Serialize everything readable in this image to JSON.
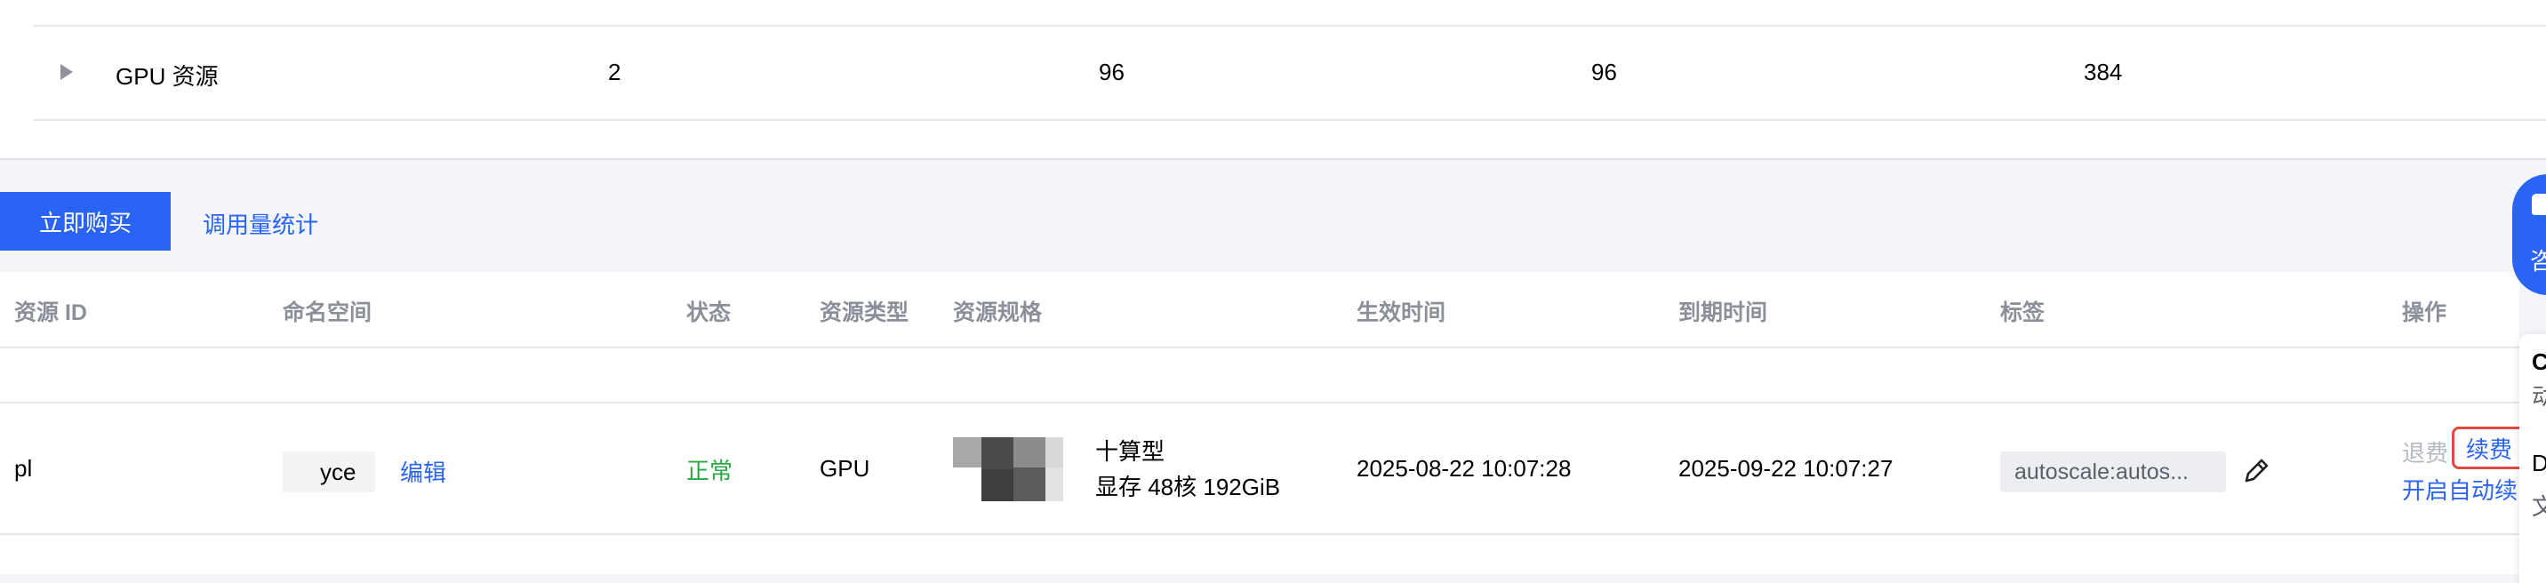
{
  "summary": {
    "row": {
      "name": "GPU 资源",
      "col2": "2",
      "col3": "96",
      "col4": "96",
      "col5": "384"
    }
  },
  "actions": {
    "buy_label": "立即购买",
    "stats_label": "调用量统计"
  },
  "floating": {
    "consult_char": "咨",
    "side_chars": [
      "C",
      "动",
      "D",
      "文"
    ]
  },
  "table": {
    "headers": [
      "资源 ID",
      "命名空间",
      "状态",
      "资源类型",
      "资源规格",
      "生效时间",
      "到期时间",
      "标签",
      "操作"
    ],
    "rows": [
      {
        "resource_id": "pl",
        "namespace": "yce",
        "edit_label": "编辑",
        "status": "正常",
        "type": "GPU",
        "spec_line1": "十算型",
        "spec_line2": "显存 48核 192GiB",
        "start_time": "2025-08-22 10:07:28",
        "end_time": "2025-09-22 10:07:27",
        "tag": "autoscale:autos...",
        "refund_label": "退费",
        "renew_label": "续费",
        "auto_renew_label": "开启自动续"
      }
    ]
  },
  "colors": {
    "primary": "#2a64f5",
    "success": "#29a744",
    "highlight": "#e2483d"
  }
}
